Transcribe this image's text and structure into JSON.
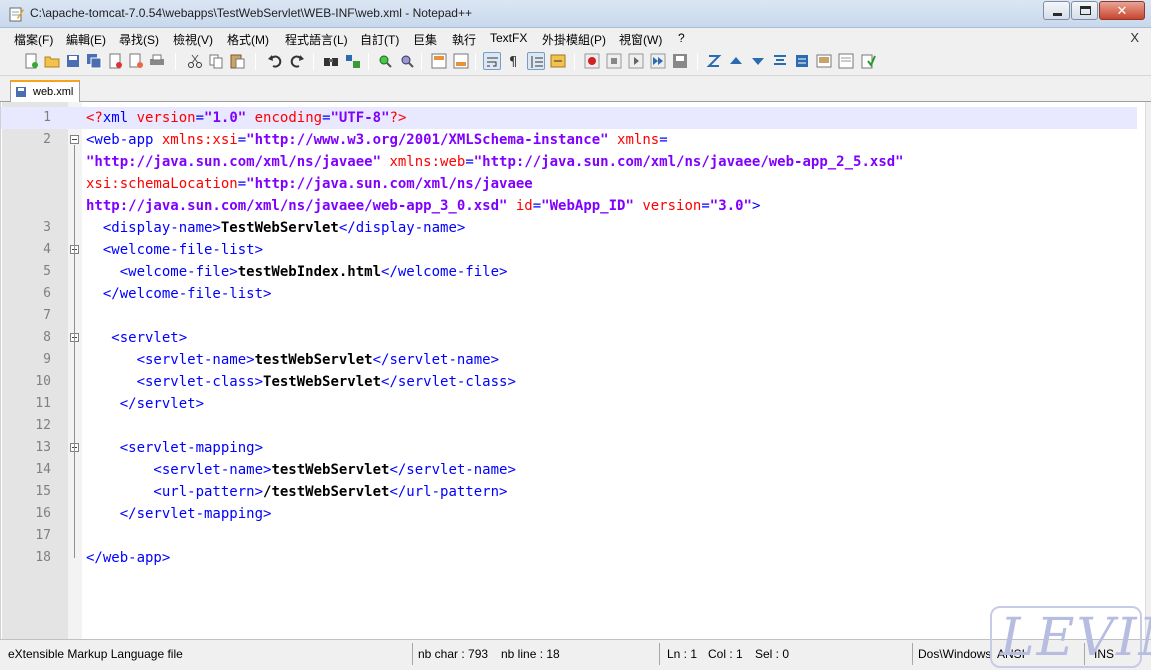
{
  "window": {
    "title": "C:\\apache-tomcat-7.0.54\\webapps\\TestWebServlet\\WEB-INF\\web.xml - Notepad++",
    "controls": {
      "minimize": "minimize",
      "maximize": "maximize",
      "close": "✕"
    }
  },
  "menu": {
    "items": [
      "檔案(F)",
      "編輯(E)",
      "尋找(S)",
      "檢視(V)",
      "格式(M)",
      "程式語言(L)",
      "自訂(T)",
      "巨集",
      "執行",
      "TextFX",
      "外掛模組(P)",
      "視窗(W)",
      "?"
    ],
    "close": "X"
  },
  "toolbar": {
    "buttons": [
      "new-file-icon",
      "open-file-icon",
      "save-icon",
      "save-all-icon",
      "close-icon",
      "close-all-icon",
      "print-icon",
      "cut-icon",
      "copy-icon",
      "paste-icon",
      "undo-icon",
      "redo-icon",
      "find-icon",
      "replace-icon",
      "zoom-in-icon",
      "zoom-out-icon",
      "sync-vertical-icon",
      "sync-horizontal-icon",
      "word-wrap-icon",
      "show-all-chars-icon",
      "indent-guide-icon",
      "user-lang-icon",
      "record-macro-icon",
      "stop-macro-icon",
      "play-macro-icon",
      "run-macro-multiple-icon",
      "save-macro-icon",
      "collapse-icon",
      "up-arrow-icon",
      "down-arrow-icon",
      "sort-icon",
      "misc-icon",
      "console-icon",
      "document-icon",
      "spellcheck-icon"
    ]
  },
  "tabs": [
    {
      "label": "web.xml",
      "active": true
    }
  ],
  "editor": {
    "current_line": 1,
    "lines": [
      {
        "num": "1",
        "fold": false,
        "segs": [
          [
            "pi",
            "<?"
          ],
          [
            "b",
            "xml "
          ],
          [
            "an",
            "version"
          ],
          [
            "b",
            "="
          ],
          [
            "av",
            "\"1.0\""
          ],
          [
            "b",
            " "
          ],
          [
            "an",
            "encoding"
          ],
          [
            "b",
            "="
          ],
          [
            "av",
            "\"UTF-8\""
          ],
          [
            "pi",
            "?>"
          ]
        ]
      },
      {
        "num": "2",
        "fold": true,
        "segs": [
          [
            "b",
            "<web-app "
          ],
          [
            "an",
            "xmlns:xsi"
          ],
          [
            "b",
            "="
          ],
          [
            "av",
            "\"http://www.w3.org/2001/XMLSchema-instance\""
          ],
          [
            "b",
            " "
          ],
          [
            "an",
            "xmlns"
          ],
          [
            "b",
            "="
          ]
        ]
      },
      {
        "num": "",
        "fold": false,
        "segs": [
          [
            "av",
            "\"http://java.sun.com/xml/ns/javaee\""
          ],
          [
            "b",
            " "
          ],
          [
            "an",
            "xmlns:web"
          ],
          [
            "b",
            "="
          ],
          [
            "av",
            "\"http://java.sun.com/xml/ns/javaee/web-app_2_5.xsd\""
          ]
        ]
      },
      {
        "num": "",
        "fold": false,
        "segs": [
          [
            "an",
            "xsi:schemaLocation"
          ],
          [
            "b",
            "="
          ],
          [
            "av",
            "\"http://java.sun.com/xml/ns/javaee"
          ]
        ]
      },
      {
        "num": "",
        "fold": false,
        "segs": [
          [
            "av",
            "http://java.sun.com/xml/ns/javaee/web-app_3_0.xsd\""
          ],
          [
            "b",
            " "
          ],
          [
            "an",
            "id"
          ],
          [
            "b",
            "="
          ],
          [
            "av",
            "\"WebApp_ID\""
          ],
          [
            "b",
            " "
          ],
          [
            "an",
            "version"
          ],
          [
            "b",
            "="
          ],
          [
            "av",
            "\"3.0\""
          ],
          [
            "b",
            ">"
          ]
        ]
      },
      {
        "num": "3",
        "fold": false,
        "segs": [
          [
            "b",
            "  <display-name>"
          ],
          [
            "tx",
            "TestWebServlet"
          ],
          [
            "b",
            "</display-name>"
          ]
        ]
      },
      {
        "num": "4",
        "fold": true,
        "segs": [
          [
            "b",
            "  <welcome-file-list>"
          ]
        ]
      },
      {
        "num": "5",
        "fold": false,
        "segs": [
          [
            "b",
            "    <welcome-file>"
          ],
          [
            "tx",
            "testWebIndex.html"
          ],
          [
            "b",
            "</welcome-file>"
          ]
        ]
      },
      {
        "num": "6",
        "fold": false,
        "segs": [
          [
            "b",
            "  </welcome-file-list>"
          ]
        ]
      },
      {
        "num": "7",
        "fold": false,
        "segs": []
      },
      {
        "num": "8",
        "fold": true,
        "segs": [
          [
            "b",
            "   <servlet>"
          ]
        ]
      },
      {
        "num": "9",
        "fold": false,
        "segs": [
          [
            "b",
            "      <servlet-name>"
          ],
          [
            "tx",
            "testWebServlet"
          ],
          [
            "b",
            "</servlet-name>"
          ]
        ]
      },
      {
        "num": "10",
        "fold": false,
        "segs": [
          [
            "b",
            "      <servlet-class>"
          ],
          [
            "tx",
            "TestWebServlet"
          ],
          [
            "b",
            "</servlet-class>"
          ]
        ]
      },
      {
        "num": "11",
        "fold": false,
        "segs": [
          [
            "b",
            "    </servlet>"
          ]
        ]
      },
      {
        "num": "12",
        "fold": false,
        "segs": []
      },
      {
        "num": "13",
        "fold": true,
        "segs": [
          [
            "b",
            "    <servlet-mapping>"
          ]
        ]
      },
      {
        "num": "14",
        "fold": false,
        "segs": [
          [
            "b",
            "        <servlet-name>"
          ],
          [
            "tx",
            "testWebServlet"
          ],
          [
            "b",
            "</servlet-name>"
          ]
        ]
      },
      {
        "num": "15",
        "fold": false,
        "segs": [
          [
            "b",
            "        <url-pattern>"
          ],
          [
            "tx",
            "/testWebServlet"
          ],
          [
            "b",
            "</url-pattern>"
          ]
        ]
      },
      {
        "num": "16",
        "fold": false,
        "segs": [
          [
            "b",
            "    </servlet-mapping>"
          ]
        ]
      },
      {
        "num": "17",
        "fold": false,
        "segs": []
      },
      {
        "num": "18",
        "fold": false,
        "segs": [
          [
            "b",
            "</web-app>"
          ]
        ]
      }
    ]
  },
  "status": {
    "filetype": "eXtensible Markup Language file",
    "nb_char": "nb char : 793",
    "nb_line": "nb line : 18",
    "ln": "Ln : 1",
    "col": "Col : 1",
    "sel": "Sel : 0",
    "eol": "Dos\\Windows",
    "encoding": "ANSI",
    "mode": "INS"
  },
  "watermark": "LEVIN",
  "colors": {
    "tag": "#0000ff",
    "attr_name": "#ff0000",
    "attr_value": "#8000ff",
    "text": "#000000",
    "current_line": "#e8e8ff",
    "tab_accent": "#f7a31b"
  }
}
